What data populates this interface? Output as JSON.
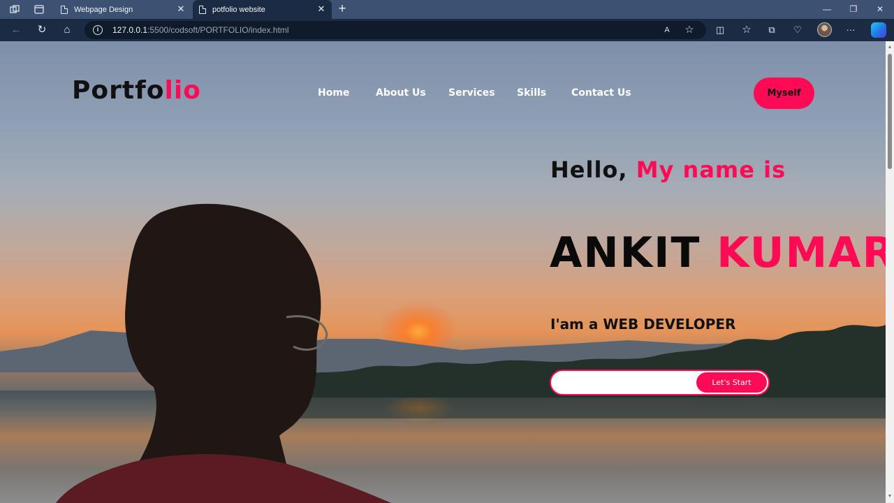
{
  "browser": {
    "tabs": [
      {
        "title": "Webpage Design",
        "active": false
      },
      {
        "title": "potfolio website",
        "active": true
      }
    ],
    "url_host": "127.0.0.1",
    "url_rest": ":5500/codsoft/PORTFOLIO/index.html",
    "icons": {
      "workspaces": "workspaces-icon",
      "tab_actions": "tab-actions-icon",
      "new_tab": "+",
      "minimize": "—",
      "maximize": "❐",
      "close": "✕",
      "back": "←",
      "refresh": "↻",
      "home": "⌂",
      "read_aloud": "A",
      "favorite": "☆",
      "split": "◫",
      "favorites": "☆",
      "collections": "⧉",
      "health": "♡",
      "more": "···"
    }
  },
  "site": {
    "logo_main": "Portfo",
    "logo_accent": "lio",
    "nav": [
      "Home",
      "About Us",
      "Services",
      "Skills",
      "Contact Us"
    ],
    "myself_button": "Myself",
    "hello_main": "Hello,",
    "hello_accent": "My name is",
    "name_first": "ANKIT",
    "name_last": "KUMAR",
    "role": "I'am a WEB DEVELOPER",
    "cta_input_value": "",
    "cta_button": "Let's Start"
  },
  "colors": {
    "accent": "#ff0a54",
    "chrome_tabbar": "#3d5273",
    "chrome_toolbar": "#1c2b44"
  }
}
